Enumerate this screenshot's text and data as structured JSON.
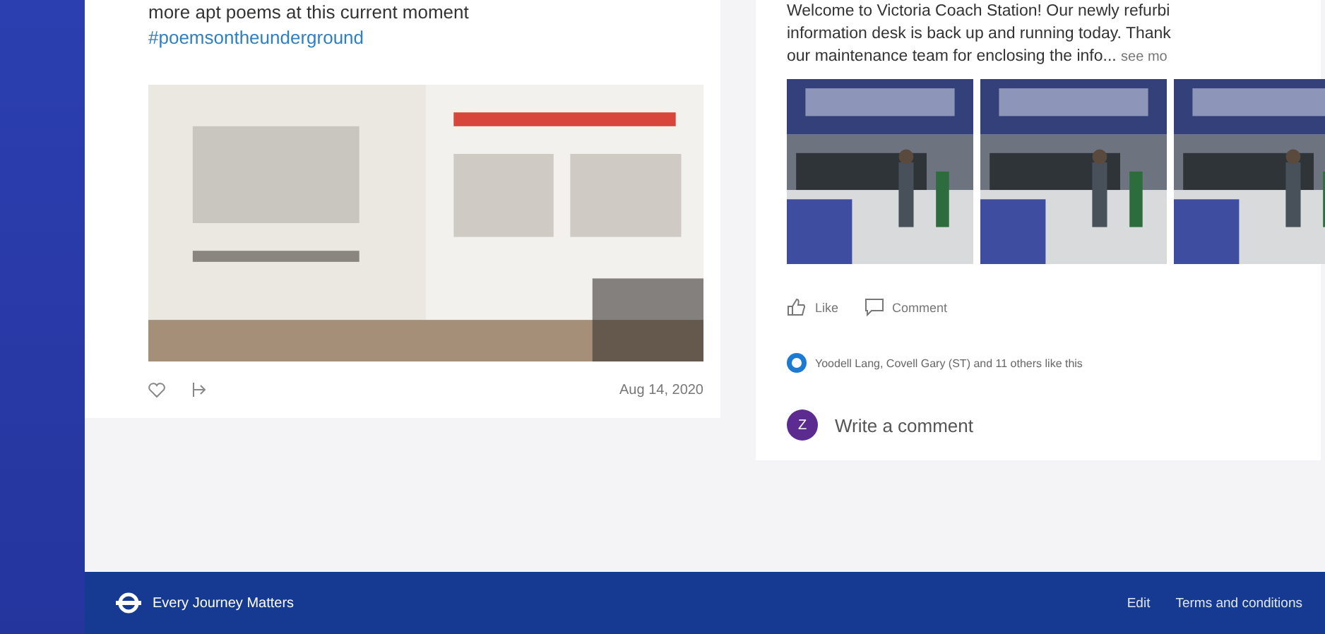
{
  "left_post": {
    "text": "more apt poems at this current moment",
    "hashtag": "#poemsontheunderground",
    "image": {
      "kind": "picture"
    },
    "date": "Aug 14, 2020"
  },
  "right_post": {
    "lines": [
      "Welcome to Victoria Coach Station! Our newly refurbi",
      "information desk is back up and running today. Thank",
      "our maintenance team for enclosing the info..."
    ],
    "see_more": "see mo",
    "photos": [
      {
        "kind": "picture"
      },
      {
        "kind": "picture"
      },
      {
        "kind": "picture"
      }
    ],
    "actions": [
      "Like",
      "Comment"
    ],
    "likes_text": "Yoodell Lang, Covell Gary (ST) and 11 others like this",
    "comment": {
      "avatar": "Z",
      "placeholder": "Write a comment"
    }
  },
  "footer": {
    "brand": "Every Journey Matters",
    "links": [
      "Edit",
      "Terms and conditions"
    ]
  }
}
